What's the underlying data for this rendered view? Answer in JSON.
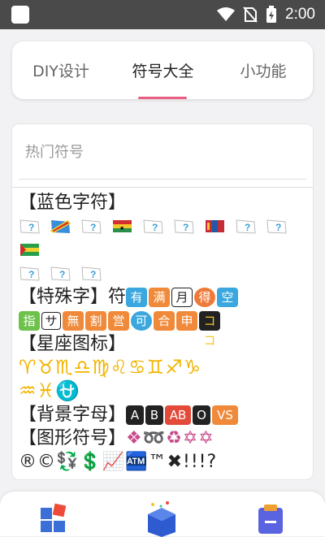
{
  "status_bar": {
    "time": "2:00",
    "icons": [
      "app-icon",
      "wifi-icon",
      "no-sim-icon",
      "battery-charging-icon"
    ]
  },
  "tabs": [
    {
      "label": "DIY设计",
      "active": false
    },
    {
      "label": "符号大全",
      "active": true
    },
    {
      "label": "小功能",
      "active": false
    }
  ],
  "accent_color": "#e95f84",
  "section": {
    "title": "热门符号"
  },
  "categories": {
    "blue": "【蓝色字符】",
    "special": "【特殊字】符",
    "zodiac": "【星座图标】",
    "bg_letters": "【背景字母】",
    "shapes": "【图形符号】"
  },
  "special_chars": {
    "row1": [
      "有",
      "满",
      "月",
      "得",
      "空"
    ],
    "row2": [
      "指",
      "サ",
      "無",
      "割",
      "営",
      "可",
      "合",
      "申",
      "ココ"
    ]
  },
  "zodiac_glyphs": {
    "row1": "♈♉♏♎♍♌♋♊♐♑",
    "row2": "♒♓⛎"
  },
  "bg_letters": [
    "A",
    "B",
    "AB",
    "O",
    "VS"
  ],
  "shapes_row1": "❖➿♻✡✡",
  "shapes_row2": "®©💱💲📈🏧™✖!!!?",
  "bottom_nav": [
    {
      "name": "diy",
      "icon": "blocks-icon"
    },
    {
      "name": "symbols",
      "icon": "gift-box-icon"
    },
    {
      "name": "tools",
      "icon": "clipboard-icon"
    }
  ]
}
